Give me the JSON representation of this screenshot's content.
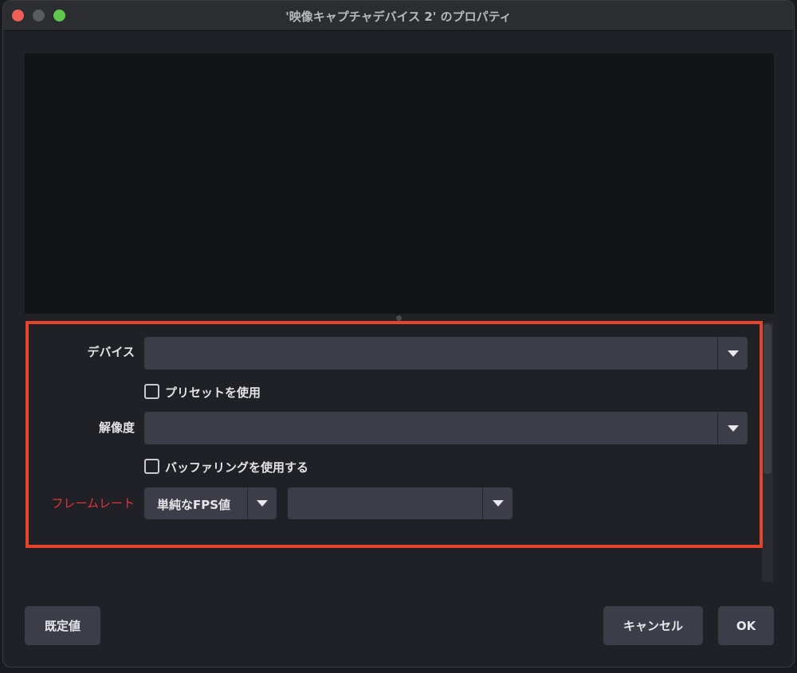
{
  "window": {
    "title": "'映像キャプチャデバイス 2' のプロパティ"
  },
  "properties": {
    "device_label": "デバイス",
    "device_value": "",
    "preset_checkbox_label": "プリセットを使用",
    "preset_checked": false,
    "resolution_label": "解像度",
    "resolution_value": "",
    "buffering_checkbox_label": "バッファリングを使用する",
    "buffering_checked": false,
    "framerate_label": "フレームレート",
    "framerate_mode_value": "単純なFPS値",
    "framerate_value": ""
  },
  "buttons": {
    "defaults": "既定値",
    "cancel": "キャンセル",
    "ok": "OK"
  },
  "colors": {
    "highlight_border": "#e5432c",
    "framerate_label": "#e0353a"
  }
}
